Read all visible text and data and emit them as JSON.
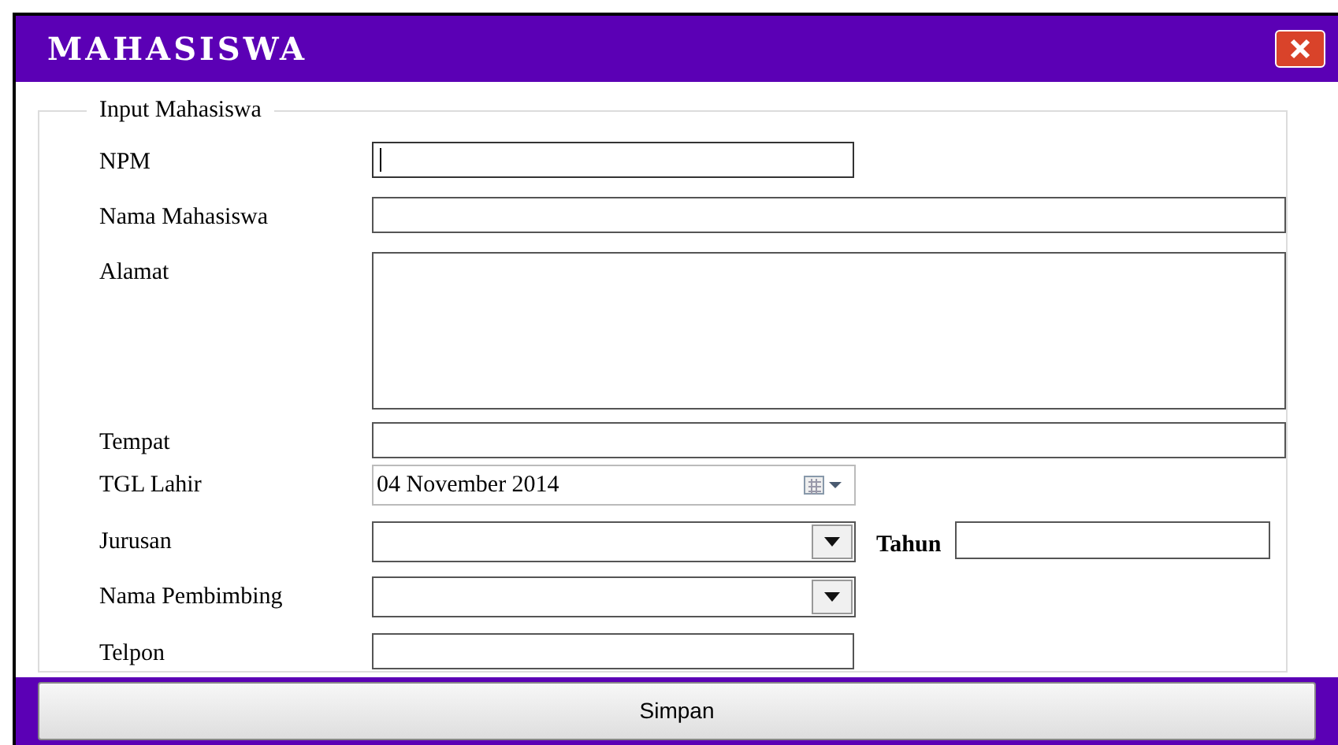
{
  "window": {
    "title": "MAHASISWA"
  },
  "group": {
    "title": "Input Mahasiswa"
  },
  "fields": [
    {
      "label": "NPM",
      "kind": "text",
      "focused": true
    },
    {
      "label": "Nama Mahasiswa",
      "kind": "text_wide",
      "focused": false
    },
    {
      "label": "Alamat",
      "kind": "textarea",
      "focused": false
    },
    {
      "label": "Tempat",
      "kind": "text_wide",
      "focused": false
    },
    {
      "label": "TGL Lahir",
      "kind": "date",
      "value": "04 November 2014",
      "focused": false
    },
    {
      "label": "Jurusan",
      "kind": "combo",
      "focused": false,
      "extra": {
        "label": "Tahun"
      }
    },
    {
      "label": "Nama Pembimbing",
      "kind": "combo",
      "focused": false
    },
    {
      "label": "Telpon",
      "kind": "text",
      "focused": false
    }
  ],
  "buttons": [
    "Simpan"
  ]
}
